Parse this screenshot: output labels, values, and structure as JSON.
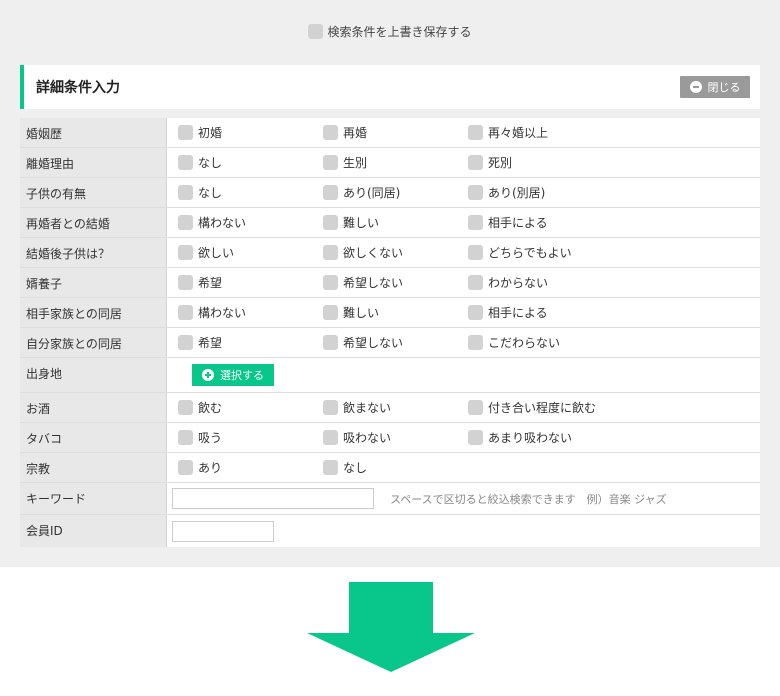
{
  "save_condition": {
    "label": "検索条件を上書き保存する"
  },
  "panel": {
    "title": "詳細条件入力",
    "close_label": "閉じる"
  },
  "rows": {
    "marriage_history": {
      "label": "婚姻歴",
      "options": [
        "初婚",
        "再婚",
        "再々婚以上"
      ]
    },
    "divorce_reason": {
      "label": "離婚理由",
      "options": [
        "なし",
        "生別",
        "死別"
      ]
    },
    "children": {
      "label": "子供の有無",
      "options": [
        "なし",
        "あり(同居)",
        "あり(別居)"
      ]
    },
    "marry_with_remarried": {
      "label": "再婚者との結婚",
      "options": [
        "構わない",
        "難しい",
        "相手による"
      ]
    },
    "children_after_marriage": {
      "label": "結婚後子供は？",
      "options": [
        "欲しい",
        "欲しくない",
        "どちらでもよい"
      ]
    },
    "adoption": {
      "label": "婿養子",
      "options": [
        "希望",
        "希望しない",
        "わからない"
      ]
    },
    "live_with_partner_family": {
      "label": "相手家族との同居",
      "options": [
        "構わない",
        "難しい",
        "相手による"
      ]
    },
    "live_with_own_family": {
      "label": "自分家族との同居",
      "options": [
        "希望",
        "希望しない",
        "こだわらない"
      ]
    },
    "birthplace": {
      "label": "出身地",
      "button_label": "選択する"
    },
    "alcohol": {
      "label": "お酒",
      "options": [
        "飲む",
        "飲まない",
        "付き合い程度に飲む"
      ]
    },
    "tobacco": {
      "label": "タバコ",
      "options": [
        "吸う",
        "吸わない",
        "あまり吸わない"
      ]
    },
    "religion": {
      "label": "宗教",
      "options": [
        "あり",
        "なし"
      ]
    },
    "keyword": {
      "label": "キーワード",
      "value": "",
      "hint": "スペースで区切ると絞込検索できます　例）音楽 ジャズ"
    },
    "member_id": {
      "label": "会員ID",
      "value": ""
    }
  },
  "colors": {
    "accent": "#09c68b",
    "close_button": "#9a9a9a",
    "checkbox": "#d2d2d2",
    "label_bg": "#e8e8e8",
    "page_bg": "#efefef"
  }
}
